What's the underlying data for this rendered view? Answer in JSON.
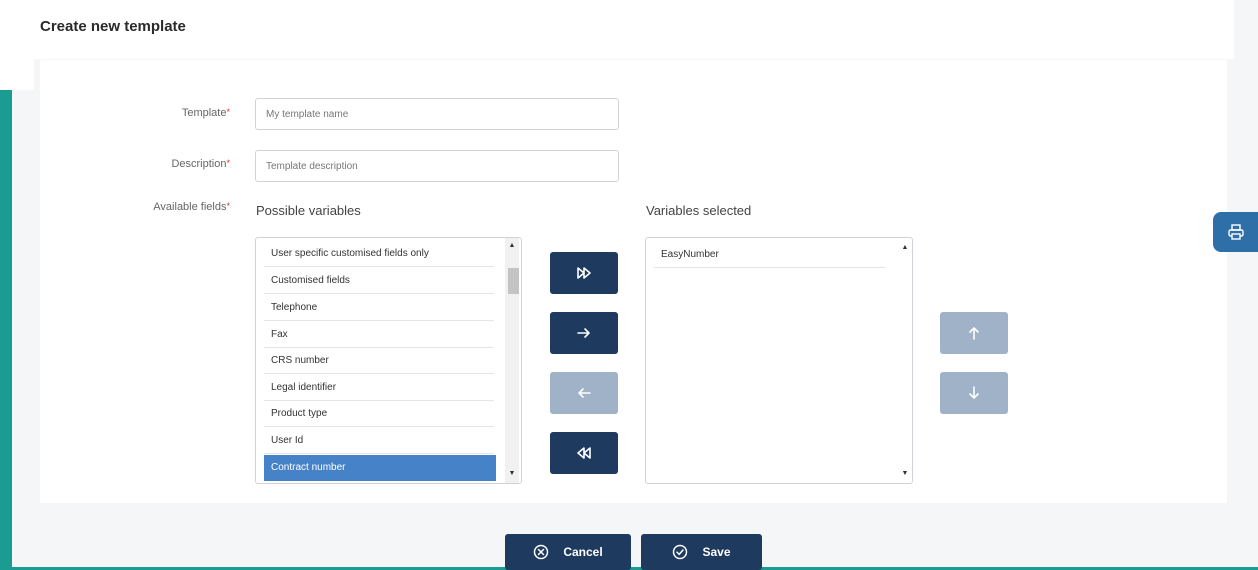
{
  "page": {
    "title": "Create new template"
  },
  "form": {
    "template_label": "Template",
    "template_placeholder": "My template name",
    "description_label": "Description",
    "description_placeholder": "Template description",
    "fields_label": "Available fields",
    "required_mark": "*"
  },
  "possible": {
    "heading": "Possible variables",
    "items": [
      "User specific customised fields only",
      "Customised fields",
      "Telephone",
      "Fax",
      "CRS number",
      "Legal identifier",
      "Product type",
      "User Id",
      "Contract number"
    ],
    "selected_item": "Contract number"
  },
  "selected": {
    "heading": "Variables selected",
    "items": [
      "EasyNumber"
    ]
  },
  "buttons": {
    "cancel": "Cancel",
    "save": "Save"
  },
  "colors": {
    "accent_dark": "#1e3a5f",
    "disabled": "#9fb2c8",
    "selection": "#4682c8",
    "frame": "#1a9c92"
  },
  "icons": {
    "add_all": "double-chevron-right-icon",
    "add": "arrow-right-icon",
    "remove": "arrow-left-icon",
    "remove_all": "double-chevron-left-icon",
    "up": "arrow-up-icon",
    "down": "arrow-down-icon",
    "print": "printer-icon"
  }
}
